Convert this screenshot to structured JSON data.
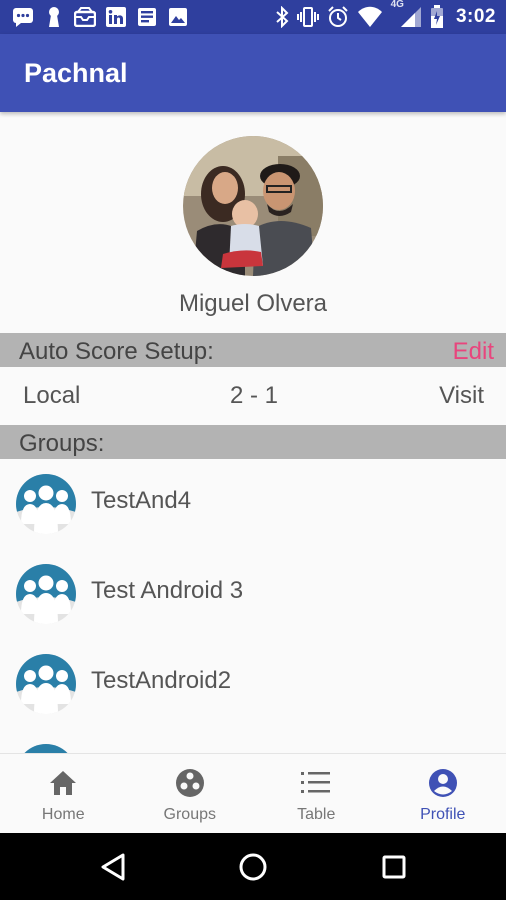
{
  "status_bar": {
    "time": "3:02",
    "network": "4G",
    "left_icons": [
      "messages-icon",
      "keyhole-icon",
      "inbox-icon",
      "linkedin-icon",
      "news-icon",
      "photo-icon"
    ],
    "right_icons": [
      "bluetooth-icon",
      "vibrate-icon",
      "alarm-icon",
      "wifi-icon",
      "signal-icon",
      "battery-icon"
    ]
  },
  "app_bar": {
    "title": "Pachnal"
  },
  "profile": {
    "name": "Miguel Olvera"
  },
  "auto_score": {
    "header": "Auto Score Setup:",
    "edit_label": "Edit",
    "local": "Local",
    "score": "2 - 1",
    "visit": "Visit"
  },
  "groups": {
    "header": "Groups:",
    "items": [
      {
        "name": "TestAnd4"
      },
      {
        "name": "Test Android 3"
      },
      {
        "name": "TestAndroid2"
      },
      {
        "name": ""
      }
    ]
  },
  "bottom_nav": {
    "items": [
      {
        "label": "Home",
        "icon": "home-icon"
      },
      {
        "label": "Groups",
        "icon": "groups-icon"
      },
      {
        "label": "Table",
        "icon": "table-icon"
      },
      {
        "label": "Profile",
        "icon": "profile-icon",
        "active": true
      }
    ]
  },
  "colors": {
    "status_bar": "#2f3f9e",
    "app_bar": "#3f51b5",
    "accent_pink": "#e8457d",
    "section_header": "#b3b3b3",
    "group_icon": "#2a7fa8"
  }
}
